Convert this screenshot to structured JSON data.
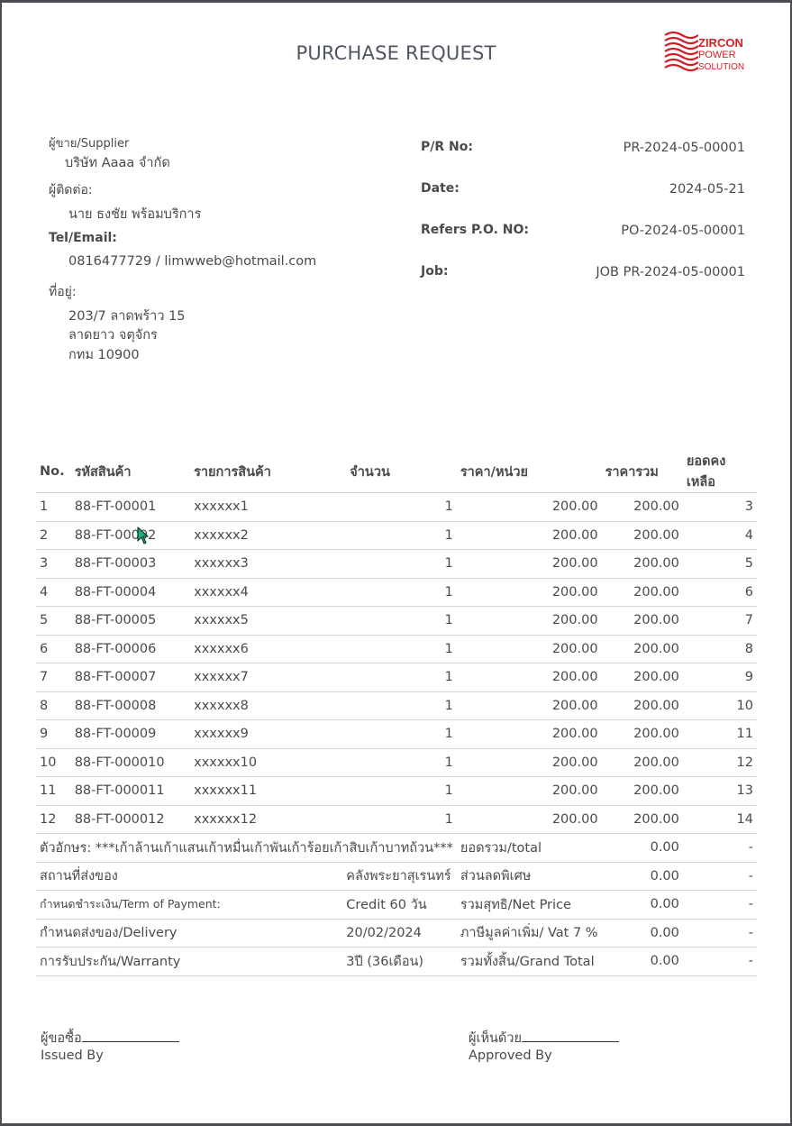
{
  "document": {
    "title": "PURCHASE REQUEST",
    "logo": {
      "line1": "ZIRCON",
      "line2": "POWER",
      "line3": "SOLUTION"
    }
  },
  "supplier": {
    "supplier_label": "ผู้ขาย/Supplier",
    "supplier_name": "บริษัท Aaaa จำกัด",
    "contact_label": "ผู้ติดต่อ:",
    "contact_name": "นาย ธงชัย พร้อมบริการ",
    "tel_label": "Tel/Email:",
    "tel_value": "0816477729 / limwweb@hotmail.com",
    "address_label": "ที่อยู่:",
    "address_line1": "203/7 ลาดพร้าว 15",
    "address_line2": "ลาดยาว จตุจักร",
    "address_line3": "กทม 10900"
  },
  "refs": {
    "pr_label": "P/R No:",
    "pr_value": "PR-2024-05-00001",
    "date_label": "Date:",
    "date_value": "2024-05-21",
    "po_label": "Refers P.O. NO:",
    "po_value": "PO-2024-05-00001",
    "job_label": "Job:",
    "job_value": "JOB PR-2024-05-00001"
  },
  "table": {
    "headers": [
      "No.",
      "รหัสสินค้า",
      "รายการสินค้า",
      "จำนวน",
      "ราคา/หน่วย",
      "ราคารวม",
      "ยอดคงเหลือ"
    ],
    "rows": [
      [
        "1",
        "88-FT-00001",
        "xxxxxx1",
        "1",
        "200.00",
        "200.00",
        "3"
      ],
      [
        "2",
        "88-FT-00002",
        "xxxxxx2",
        "1",
        "200.00",
        "200.00",
        "4"
      ],
      [
        "3",
        "88-FT-00003",
        "xxxxxx3",
        "1",
        "200.00",
        "200.00",
        "5"
      ],
      [
        "4",
        "88-FT-00004",
        "xxxxxx4",
        "1",
        "200.00",
        "200.00",
        "6"
      ],
      [
        "5",
        "88-FT-00005",
        "xxxxxx5",
        "1",
        "200.00",
        "200.00",
        "7"
      ],
      [
        "6",
        "88-FT-00006",
        "xxxxxx6",
        "1",
        "200.00",
        "200.00",
        "8"
      ],
      [
        "7",
        "88-FT-00007",
        "xxxxxx7",
        "1",
        "200.00",
        "200.00",
        "9"
      ],
      [
        "8",
        "88-FT-00008",
        "xxxxxx8",
        "1",
        "200.00",
        "200.00",
        "10"
      ],
      [
        "9",
        "88-FT-00009",
        "xxxxxx9",
        "1",
        "200.00",
        "200.00",
        "11"
      ],
      [
        "10",
        "88-FT-000010",
        "xxxxxx10",
        "1",
        "200.00",
        "200.00",
        "12"
      ],
      [
        "11",
        "88-FT-000011",
        "xxxxxx11",
        "1",
        "200.00",
        "200.00",
        "13"
      ],
      [
        "12",
        "88-FT-000012",
        "xxxxxx12",
        "1",
        "200.00",
        "200.00",
        "14"
      ]
    ]
  },
  "summary": {
    "words": "ตัวอักษร: ***เก้าล้านเก้าแสนเก้าหมื่นเก้าพันเก้าร้อยเก้าสิบเก้าบาทถ้วน***",
    "total_label": "ยอดรวม/total",
    "total_value": "0.00",
    "total_extra": "-",
    "place_label": "สถานที่ส่งของ",
    "place_value": "คลังพระยาสุเรนทร์",
    "discount_label": "ส่วนลดพิเศษ",
    "discount_value": "0.00",
    "discount_extra": "-",
    "payment_label": "กำหนดชำระเงิน/Term of Payment:",
    "payment_value": "Credit 60 วัน",
    "net_label": "รวมสุทธิ/Net Price",
    "net_value": "0.00",
    "net_extra": "-",
    "delivery_label": "กำหนดส่งของ/Delivery",
    "delivery_value": "20/02/2024",
    "vat_label": "ภาษีมูลค่าเพิ่ม/ Vat 7 %",
    "vat_value": "0.00",
    "vat_extra": "-",
    "warranty_label": "การรับประกัน/Warranty",
    "warranty_value": "3ปี (36เดือน)",
    "grand_label": "รวมทั้งสิ้น/Grand Total",
    "grand_value": "0.00",
    "grand_extra": "-"
  },
  "signatures": {
    "issued_th": "ผู้ขอซื้อ",
    "issued_en": "Issued By",
    "approved_th": "ผู้เห็นด้วย",
    "approved_en": "Approved By"
  },
  "colors": {
    "logo_red": "#d41e24",
    "text": "#4a4a4a",
    "background": "#4a4d52"
  },
  "icons": {
    "cursor": "mouse-pointer-icon"
  }
}
